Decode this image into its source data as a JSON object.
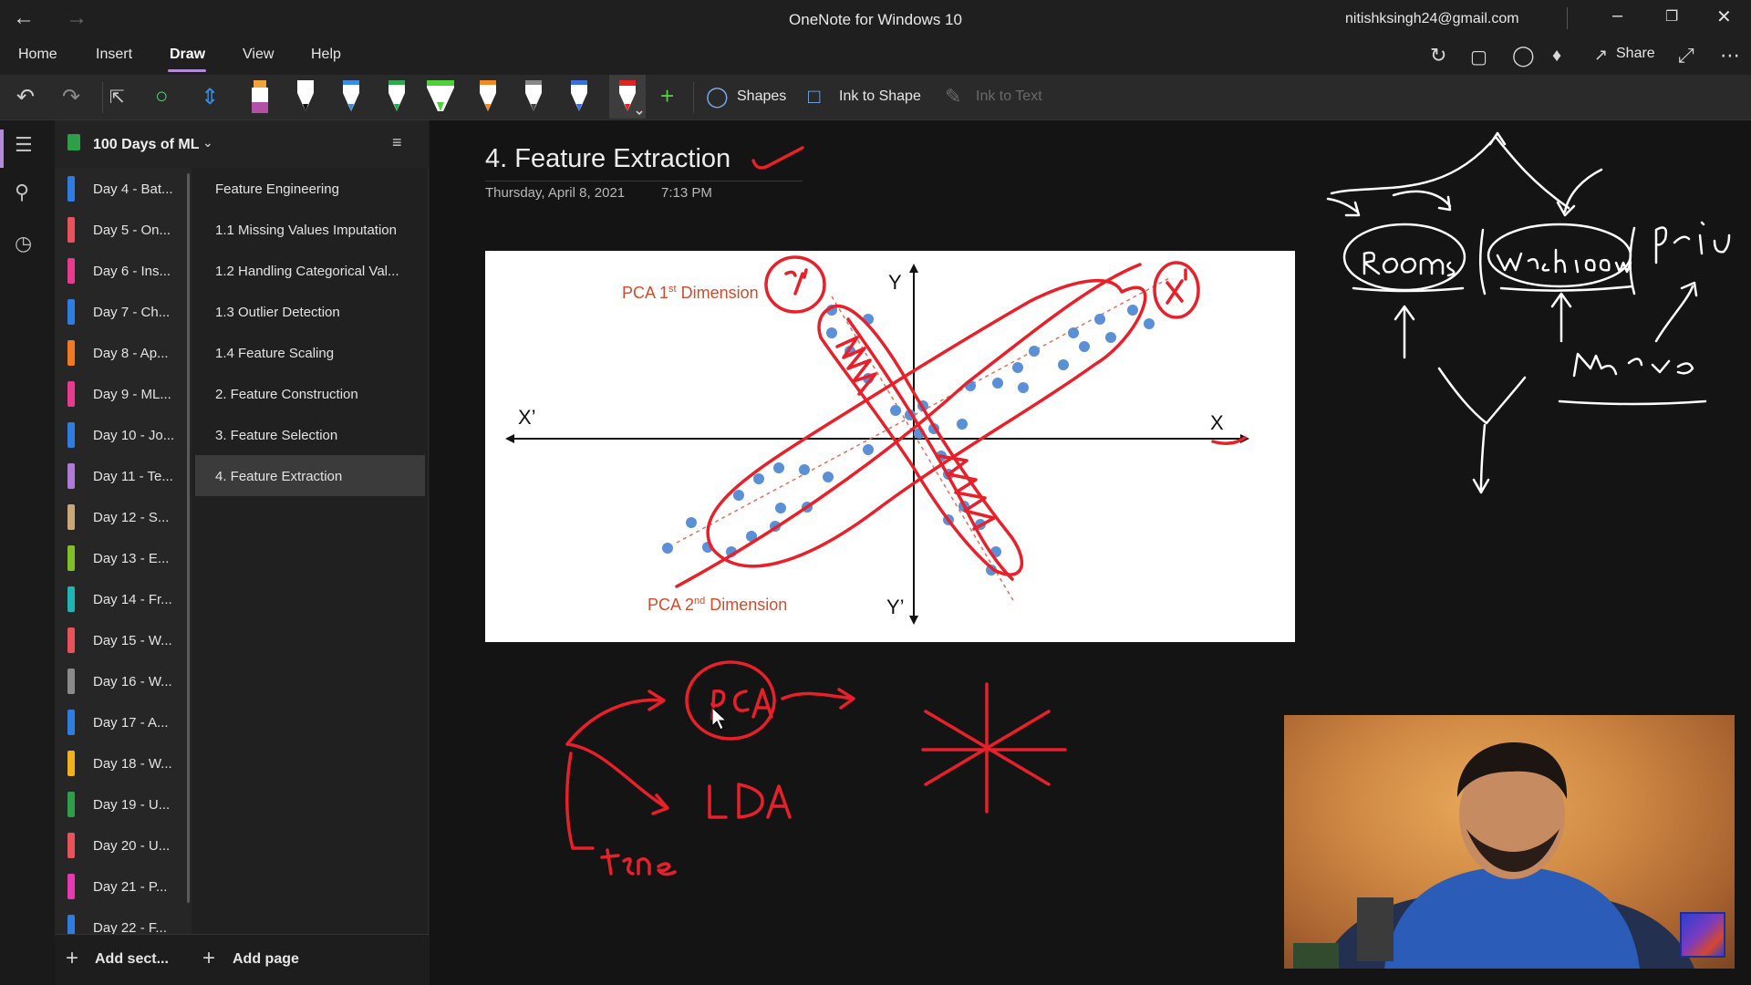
{
  "titlebar": {
    "app_title": "OneNote for Windows 10",
    "account": "nitishksingh24@gmail.com"
  },
  "menu": {
    "tabs": [
      "Home",
      "Insert",
      "Draw",
      "View",
      "Help"
    ],
    "active_tab": "Draw",
    "share_label": "Share"
  },
  "ribbon": {
    "shapes_label": "Shapes",
    "ink_to_shape_label": "Ink to Shape",
    "ink_to_text_label": "Ink to Text",
    "pens": [
      {
        "name": "highlighter-orange",
        "color": "#f2a33a",
        "tip": "#b44fa8"
      },
      {
        "name": "pen-black",
        "color": "#ffffff",
        "tip": "#111111"
      },
      {
        "name": "pen-blue",
        "color": "#ffffff",
        "tip": "#3a8de0"
      },
      {
        "name": "pen-green",
        "color": "#ffffff",
        "tip": "#2fa84f"
      },
      {
        "name": "highlighter-green",
        "color": "#ffffff",
        "tip": "#4fd13a"
      },
      {
        "name": "pen-orange",
        "color": "#ffffff",
        "tip": "#f08a24"
      },
      {
        "name": "pen-gray",
        "color": "#ffffff",
        "tip": "#888888"
      },
      {
        "name": "pen-lightblue",
        "color": "#ffffff",
        "tip": "#3a6fe0"
      },
      {
        "name": "pen-red",
        "color": "#ffffff",
        "tip": "#e02424"
      }
    ]
  },
  "notebook": {
    "name": "100 Days of ML",
    "add_section_label": "Add sect...",
    "add_page_label": "Add page",
    "sections": [
      {
        "label": "Day 4 - Bat...",
        "color": "#2f7de0"
      },
      {
        "label": "Day 5 - On...",
        "color": "#e8525a"
      },
      {
        "label": "Day 6 - Ins...",
        "color": "#e83a8e"
      },
      {
        "label": "Day 7 - Ch...",
        "color": "#2f7de0"
      },
      {
        "label": "Day 8 - Ap...",
        "color": "#f07a24"
      },
      {
        "label": "Day 9 - ML...",
        "color": "#e83a8e"
      },
      {
        "label": "Day 10 - Jo...",
        "color": "#2f7de0"
      },
      {
        "label": "Day 11 - Te...",
        "color": "#b07ad8"
      },
      {
        "label": "Day 12 - S...",
        "color": "#c9a77a"
      },
      {
        "label": "Day 13 - E...",
        "color": "#7fbf2a"
      },
      {
        "label": "Day 14 - Fr...",
        "color": "#1fb5b5"
      },
      {
        "label": "Day 15 - W...",
        "color": "#e8525a"
      },
      {
        "label": "Day 16 - W...",
        "color": "#8a8a8a"
      },
      {
        "label": "Day 17 - A...",
        "color": "#2f7de0"
      },
      {
        "label": "Day 18 - W...",
        "color": "#f0b020"
      },
      {
        "label": "Day 19 - U...",
        "color": "#2f9e48"
      },
      {
        "label": "Day 20 - U...",
        "color": "#e8525a"
      },
      {
        "label": "Day 21 - P...",
        "color": "#e83ab0"
      },
      {
        "label": "Day 22 - F...",
        "color": "#2f7de0"
      }
    ],
    "pages": [
      {
        "label": "Feature Engineering"
      },
      {
        "label": "1.1 Missing Values Imputation"
      },
      {
        "label": "1.2 Handling Categorical Val..."
      },
      {
        "label": "1.3 Outlier Detection"
      },
      {
        "label": "1.4 Feature Scaling"
      },
      {
        "label": "2. Feature Construction"
      },
      {
        "label": "3. Feature Selection"
      },
      {
        "label": "4. Feature Extraction"
      }
    ],
    "selected_page_index": 7
  },
  "page": {
    "title": "4. Feature Extraction",
    "date": "Thursday, April 8, 2021",
    "time": "7:13 PM"
  },
  "diagram": {
    "pca1_prefix": "PCA 1",
    "pca1_sup": "st",
    "pca1_suffix": " Dimension",
    "pca2_prefix": "PCA 2",
    "pca2_sup": "nd",
    "pca2_suffix": " Dimension",
    "axis_x": "X",
    "axis_x_neg": "X’",
    "axis_y": "Y",
    "axis_y_neg": "Y’"
  },
  "colors": {
    "ink_red": "#e8202a",
    "accent_purple": "#b38bd9",
    "point_blue": "#5b8fd6"
  }
}
